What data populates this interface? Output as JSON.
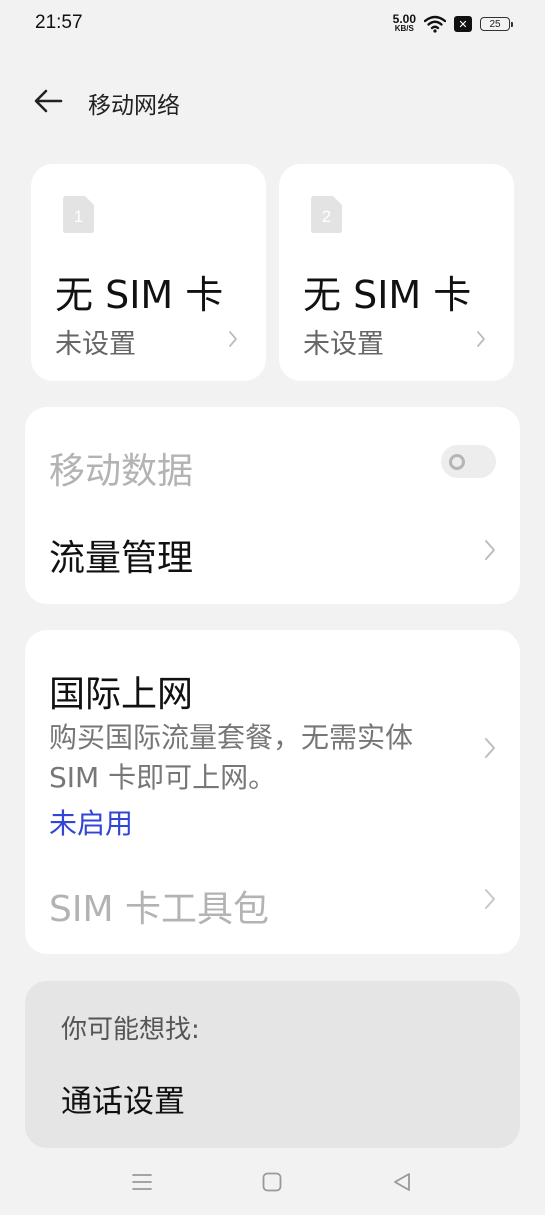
{
  "status_bar": {
    "time": "21:57",
    "net_speed_value": "5.00",
    "net_speed_unit": "KB/S",
    "battery": "25",
    "icons": [
      "wifi-icon",
      "no-sim-icon",
      "battery-icon"
    ]
  },
  "header": {
    "title": "移动网络",
    "back_icon": "back-arrow-icon"
  },
  "sim_cards": [
    {
      "slot": "1",
      "title": "无 SIM 卡",
      "status": "未设置"
    },
    {
      "slot": "2",
      "title": "无 SIM 卡",
      "status": "未设置"
    }
  ],
  "data_section": {
    "mobile_data_label": "移动数据",
    "mobile_data_enabled": false,
    "traffic_label": "流量管理"
  },
  "intl_section": {
    "title": "国际上网",
    "description": "购买国际流量套餐，无需实体SIM 卡即可上网。",
    "status": "未启用",
    "toolkit_label": "SIM 卡工具包"
  },
  "suggestions": {
    "heading": "你可能想找:",
    "items": [
      "通话设置"
    ]
  },
  "colors": {
    "background": "#f2f2f2",
    "card": "#ffffff",
    "accent_blue": "#3345d6",
    "disabled_text": "#b3b3b3"
  },
  "nav_bar": {
    "icons": [
      "menu-icon",
      "home-icon",
      "back-icon"
    ]
  }
}
